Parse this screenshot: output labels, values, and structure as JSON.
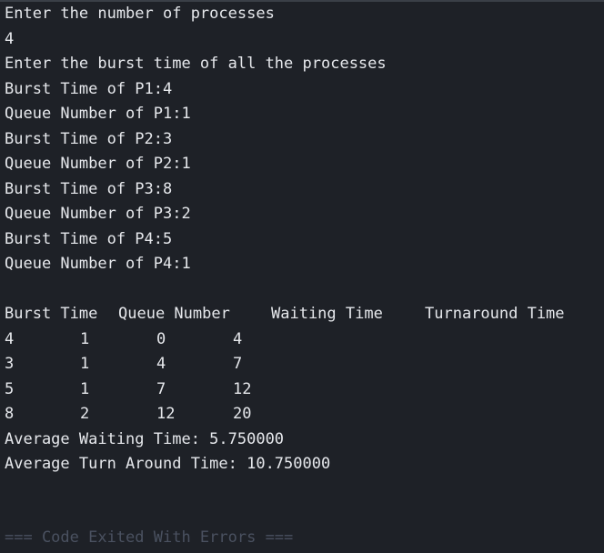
{
  "output": {
    "lines": [
      "Enter the number of processes",
      "4",
      "Enter the burst time of all the processes",
      "Burst Time of P1:4",
      "Queue Number of P1:1",
      "Burst Time of P2:3",
      "Queue Number of P2:1",
      "Burst Time of P3:8",
      "Queue Number of P3:2",
      "Burst Time of P4:5",
      "Queue Number of P4:1"
    ],
    "table": {
      "headers": [
        "Burst Time",
        "Queue Number",
        "Waiting Time",
        "Turnaround Time"
      ],
      "rows": [
        [
          "4",
          "1",
          "0",
          "4"
        ],
        [
          "3",
          "1",
          "4",
          "7"
        ],
        [
          "5",
          "1",
          "7",
          "12"
        ],
        [
          "8",
          "2",
          "12",
          "20"
        ]
      ]
    },
    "avg_waiting": "Average Waiting Time: 5.750000",
    "avg_turnaround": "Average Turn Around Time: 10.750000"
  },
  "status": {
    "footer": "=== Code Exited With Errors ==="
  }
}
